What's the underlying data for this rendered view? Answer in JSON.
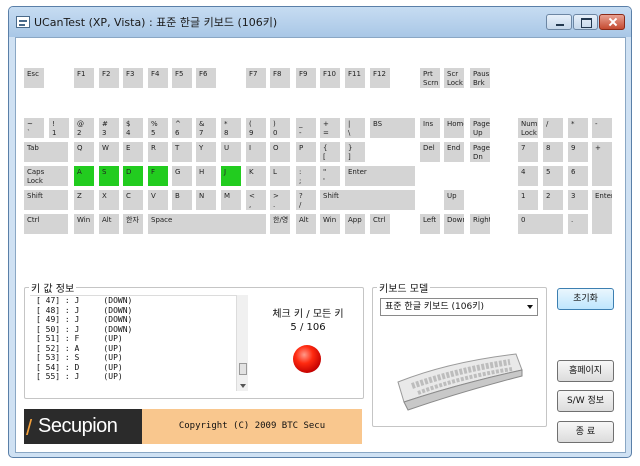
{
  "window": {
    "title": "UCanTest (XP, Vista) : 표준 한글 키보드 (106키)"
  },
  "keyboard": {
    "keys": [
      {
        "label": "Esc",
        "pressed": false
      },
      {
        "label": "F1",
        "pressed": false
      },
      {
        "label": "F2",
        "pressed": false
      },
      {
        "label": "F3",
        "pressed": false
      },
      {
        "label": "F4",
        "pressed": false
      },
      {
        "label": "F5",
        "pressed": false
      },
      {
        "label": "F6",
        "pressed": false
      },
      {
        "label": "F7",
        "pressed": false
      },
      {
        "label": "F8",
        "pressed": false
      },
      {
        "label": "F9",
        "pressed": false
      },
      {
        "label": "F10",
        "pressed": false
      },
      {
        "label": "F11",
        "pressed": false
      },
      {
        "label": "F12",
        "pressed": false
      },
      {
        "label": "Prt\nScrn",
        "pressed": false
      },
      {
        "label": "Scr\nLock",
        "pressed": false
      },
      {
        "label": "Paus\nBrk",
        "pressed": false
      },
      {
        "label": "~\n`",
        "pressed": false
      },
      {
        "label": "!\n1",
        "pressed": false
      },
      {
        "label": "@\n2",
        "pressed": false
      },
      {
        "label": "#\n3",
        "pressed": false
      },
      {
        "label": "$\n4",
        "pressed": false
      },
      {
        "label": "%\n5",
        "pressed": false
      },
      {
        "label": "^\n6",
        "pressed": false
      },
      {
        "label": "&\n7",
        "pressed": false
      },
      {
        "label": "*\n8",
        "pressed": false
      },
      {
        "label": "(\n9",
        "pressed": false
      },
      {
        "label": ")\n0",
        "pressed": false
      },
      {
        "label": "_\n-",
        "pressed": false
      },
      {
        "label": "+\n=",
        "pressed": false
      },
      {
        "label": "|\n\\",
        "pressed": false
      },
      {
        "label": "BS",
        "pressed": false
      },
      {
        "label": "Ins",
        "pressed": false
      },
      {
        "label": "Home",
        "pressed": false
      },
      {
        "label": "Page\nUp",
        "pressed": false
      },
      {
        "label": "Num\nLock",
        "pressed": false
      },
      {
        "label": "/",
        "pressed": false
      },
      {
        "label": "*",
        "pressed": false
      },
      {
        "label": "-",
        "pressed": false
      },
      {
        "label": "Tab",
        "pressed": false
      },
      {
        "label": "Q",
        "pressed": false
      },
      {
        "label": "W",
        "pressed": false
      },
      {
        "label": "E",
        "pressed": false
      },
      {
        "label": "R",
        "pressed": false
      },
      {
        "label": "T",
        "pressed": false
      },
      {
        "label": "Y",
        "pressed": false
      },
      {
        "label": "U",
        "pressed": false
      },
      {
        "label": "I",
        "pressed": false
      },
      {
        "label": "O",
        "pressed": false
      },
      {
        "label": "P",
        "pressed": false
      },
      {
        "label": "{\n[",
        "pressed": false
      },
      {
        "label": "}\n]",
        "pressed": false
      },
      {
        "label": "Del",
        "pressed": false
      },
      {
        "label": "End",
        "pressed": false
      },
      {
        "label": "Page\nDn",
        "pressed": false
      },
      {
        "label": "7",
        "pressed": false
      },
      {
        "label": "8",
        "pressed": false
      },
      {
        "label": "9",
        "pressed": false
      },
      {
        "label": "+",
        "pressed": false
      },
      {
        "label": "Caps\nLock",
        "pressed": false
      },
      {
        "label": "A",
        "pressed": true
      },
      {
        "label": "S",
        "pressed": true
      },
      {
        "label": "D",
        "pressed": true
      },
      {
        "label": "F",
        "pressed": true
      },
      {
        "label": "G",
        "pressed": false
      },
      {
        "label": "H",
        "pressed": false
      },
      {
        "label": "J",
        "pressed": true
      },
      {
        "label": "K",
        "pressed": false
      },
      {
        "label": "L",
        "pressed": false
      },
      {
        "label": ":\n;",
        "pressed": false
      },
      {
        "label": "\"\n'",
        "pressed": false
      },
      {
        "label": "Enter",
        "pressed": false
      },
      {
        "label": "4",
        "pressed": false
      },
      {
        "label": "5",
        "pressed": false
      },
      {
        "label": "6",
        "pressed": false
      },
      {
        "label": "Shift",
        "pressed": false
      },
      {
        "label": "Z",
        "pressed": false
      },
      {
        "label": "X",
        "pressed": false
      },
      {
        "label": "C",
        "pressed": false
      },
      {
        "label": "V",
        "pressed": false
      },
      {
        "label": "B",
        "pressed": false
      },
      {
        "label": "N",
        "pressed": false
      },
      {
        "label": "M",
        "pressed": false
      },
      {
        "label": "<\n,",
        "pressed": false
      },
      {
        "label": ">\n.",
        "pressed": false
      },
      {
        "label": "?\n/",
        "pressed": false
      },
      {
        "label": "Shift",
        "pressed": false
      },
      {
        "label": "Up",
        "pressed": false
      },
      {
        "label": "1",
        "pressed": false
      },
      {
        "label": "2",
        "pressed": false
      },
      {
        "label": "3",
        "pressed": false
      },
      {
        "label": "Enter",
        "pressed": false
      },
      {
        "label": "Ctrl",
        "pressed": false
      },
      {
        "label": "Win",
        "pressed": false
      },
      {
        "label": "Alt",
        "pressed": false
      },
      {
        "label": "한자",
        "pressed": false
      },
      {
        "label": "Space",
        "pressed": false
      },
      {
        "label": "한/영",
        "pressed": false
      },
      {
        "label": "Alt",
        "pressed": false
      },
      {
        "label": "Win",
        "pressed": false
      },
      {
        "label": "App",
        "pressed": false
      },
      {
        "label": "Ctrl",
        "pressed": false
      },
      {
        "label": "Left",
        "pressed": false
      },
      {
        "label": "Down",
        "pressed": false
      },
      {
        "label": "Right",
        "pressed": false
      },
      {
        "label": "0",
        "pressed": false
      },
      {
        "label": ".",
        "pressed": false
      }
    ],
    "pressed_color": "#22cc1f",
    "key_color": "#d4d4d4"
  },
  "key_info": {
    "title": "키 값 정보",
    "log": [
      "[ 47] : J     (DOWN)",
      "[ 48] : J     (DOWN)",
      "[ 49] : J     (DOWN)",
      "[ 50] : J     (DOWN)",
      "[ 51] : F     (UP)",
      "[ 52] : A     (UP)",
      "[ 53] : S     (UP)",
      "[ 54] : D     (UP)",
      "[ 55] : J     (UP)"
    ],
    "check_label": "체크 키 / 모든 키",
    "count": "5 / 106",
    "checked": 5,
    "total": 106,
    "status_color": "#ff2a10"
  },
  "keyboard_model": {
    "title": "키보드 모델",
    "selected": "표준 한글 키보드 (106키)"
  },
  "buttons": {
    "reset": "초기화",
    "homepage": "홈페이지",
    "sw_info": "S/W 정보",
    "exit": "종  료"
  },
  "footer": {
    "logo": "Secupion",
    "copyright": "Copyright (C) 2009 BTC Secu"
  },
  "icons": [
    "app-icon",
    "minimize-icon",
    "maximize-icon",
    "close-icon",
    "status-light-icon",
    "keyboard-image"
  ]
}
